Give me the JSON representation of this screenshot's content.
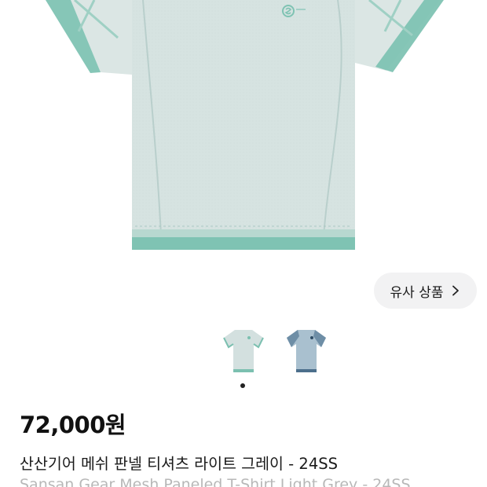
{
  "product": {
    "price": "72,000원",
    "title_ko": "산산기어 메쉬 판넬 티셔츠 라이트 그레이 - 24SS",
    "title_en": "Sansan Gear Mesh Paneled T-Shirt Light Grey - 24SS"
  },
  "similar_button": {
    "label": "유사 상품",
    "icon": "chevron-right-icon"
  },
  "gallery": {
    "main_image": "light-grey-tshirt-image",
    "thumbnails": [
      {
        "name": "light-grey-tshirt",
        "color": "#d3e0df",
        "accent": "#7cc0b0"
      },
      {
        "name": "blue-tshirt",
        "color": "#a9c0cf",
        "accent": "#4c6f8c"
      }
    ],
    "page_dots": 1
  },
  "colors": {
    "shirt_body": "#d6e3e1",
    "shirt_trim": "#7fc3b3",
    "button_bg": "#f2f2f3"
  }
}
